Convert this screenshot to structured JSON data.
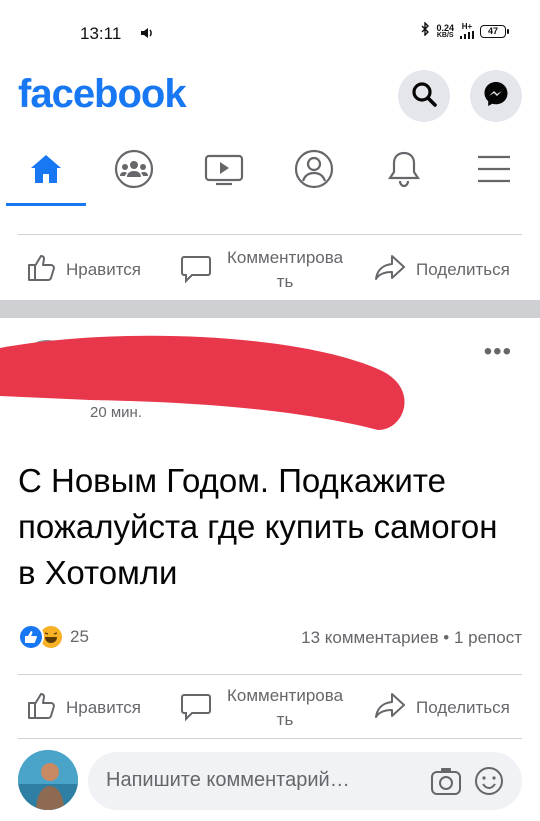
{
  "status_bar": {
    "time": "13:11",
    "net_speed": "0.24",
    "net_unit": "KB/S",
    "network_type": "H+",
    "battery": "47"
  },
  "header": {
    "logo": "facebook",
    "icons": [
      "search-icon",
      "messenger-icon"
    ]
  },
  "tabs": [
    {
      "icon": "home-icon",
      "active": true
    },
    {
      "icon": "groups-icon",
      "active": false
    },
    {
      "icon": "watch-icon",
      "active": false
    },
    {
      "icon": "profile-icon",
      "active": false
    },
    {
      "icon": "notifications-icon",
      "active": false
    },
    {
      "icon": "menu-icon",
      "active": false
    }
  ],
  "prev_post_actions": {
    "like": "Нравится",
    "comment_line1": "Комментирова",
    "comment_line2": "ть",
    "share": "Поделиться"
  },
  "post": {
    "time": "20 мин.",
    "text": "С Новым Годом. Подкажите пожалуйста где купить самогон в Хотомли",
    "reaction_count": "25",
    "stats": "13 комментариев • 1 репост",
    "actions": {
      "like": "Нравится",
      "comment_line1": "Комментирова",
      "comment_line2": "ть",
      "share": "Поделиться"
    }
  },
  "composer": {
    "placeholder": "Напишите комментарий…"
  },
  "colors": {
    "brand": "#1877f2",
    "redaction": "#e8364b",
    "muted": "#65676b"
  }
}
